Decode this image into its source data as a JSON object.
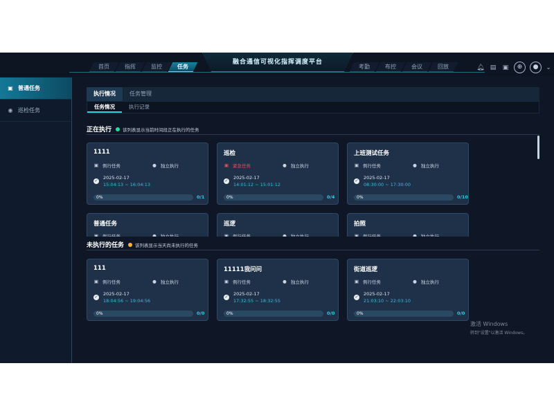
{
  "header": {
    "title": "融合通信可视化指挥调度平台",
    "nav_left": [
      "首页",
      "指挥",
      "监控",
      "任务"
    ],
    "nav_right": [
      "考勤",
      "布控",
      "会议",
      "回放"
    ],
    "active_nav": "任务",
    "icons": [
      "bell-icon",
      "panel-icon",
      "window-icon",
      "compass-icon",
      "user-icon",
      "chevron-down-icon"
    ]
  },
  "sidebar": {
    "items": [
      {
        "label": "普通任务",
        "icon": "clipboard-icon",
        "active": true
      },
      {
        "label": "巡检任务",
        "icon": "target-icon",
        "active": false
      }
    ]
  },
  "tabs_primary": [
    "执行情况",
    "任务管理"
  ],
  "tabs_secondary": [
    "任务情况",
    "执行记录"
  ],
  "sections": {
    "running": {
      "title": "正在执行",
      "note": "该列表显示当前时间段正在执行的任务",
      "dot_color": "#2bd9a0"
    },
    "pending": {
      "title": "未执行的任务",
      "note": "该列表显示当天尚未执行的任务",
      "dot_color": "#f2b43a"
    }
  },
  "running_cards": [
    {
      "title": "1111",
      "type": "例行任务",
      "mode": "独立执行",
      "date": "2025-02-17",
      "range": "15:04:13 ~ 16:04:13",
      "progress": "0%",
      "progress_value": 0,
      "count": "0/1"
    },
    {
      "title": "巡检",
      "type": "紧急任务",
      "urgent": true,
      "mode": "独立执行",
      "date": "2025-02-17",
      "range": "14:01:12 ~ 15:01:12",
      "progress": "0%",
      "progress_value": 0,
      "count": "0/4"
    },
    {
      "title": "上班测试任务",
      "type": "例行任务",
      "mode": "独立执行",
      "date": "2025-02-17",
      "range": "08:30:00 ~ 17:30:00",
      "progress": "0%",
      "progress_value": 0,
      "count": "0/10"
    },
    {
      "title": "普通任务",
      "type": "例行任务",
      "mode": "独立执行"
    },
    {
      "title": "巡逻",
      "type": "例行任务",
      "mode": "独立执行"
    },
    {
      "title": "拍照",
      "type": "例行任务",
      "mode": "独立执行"
    }
  ],
  "pending_cards": [
    {
      "title": "111",
      "type": "例行任务",
      "mode": "独立执行",
      "date": "2025-02-17",
      "range": "18:04:56 ~ 19:04:56",
      "progress": "0%",
      "progress_value": 0,
      "count": "0/0"
    },
    {
      "title": "11111我问问",
      "type": "例行任务",
      "mode": "独立执行",
      "date": "2025-02-17",
      "range": "17:32:55 ~ 18:32:55",
      "progress": "0%",
      "progress_value": 0,
      "count": "0/0"
    },
    {
      "title": "街道巡逻",
      "type": "例行任务",
      "mode": "独立执行",
      "date": "2025-02-17",
      "range": "21:03:10 ~ 22:03:10",
      "progress": "0%",
      "progress_value": 0,
      "count": "0/0"
    }
  ],
  "watermark": {
    "line1": "激活 Windows",
    "line2": "转到\"设置\"以激活 Windows。"
  }
}
